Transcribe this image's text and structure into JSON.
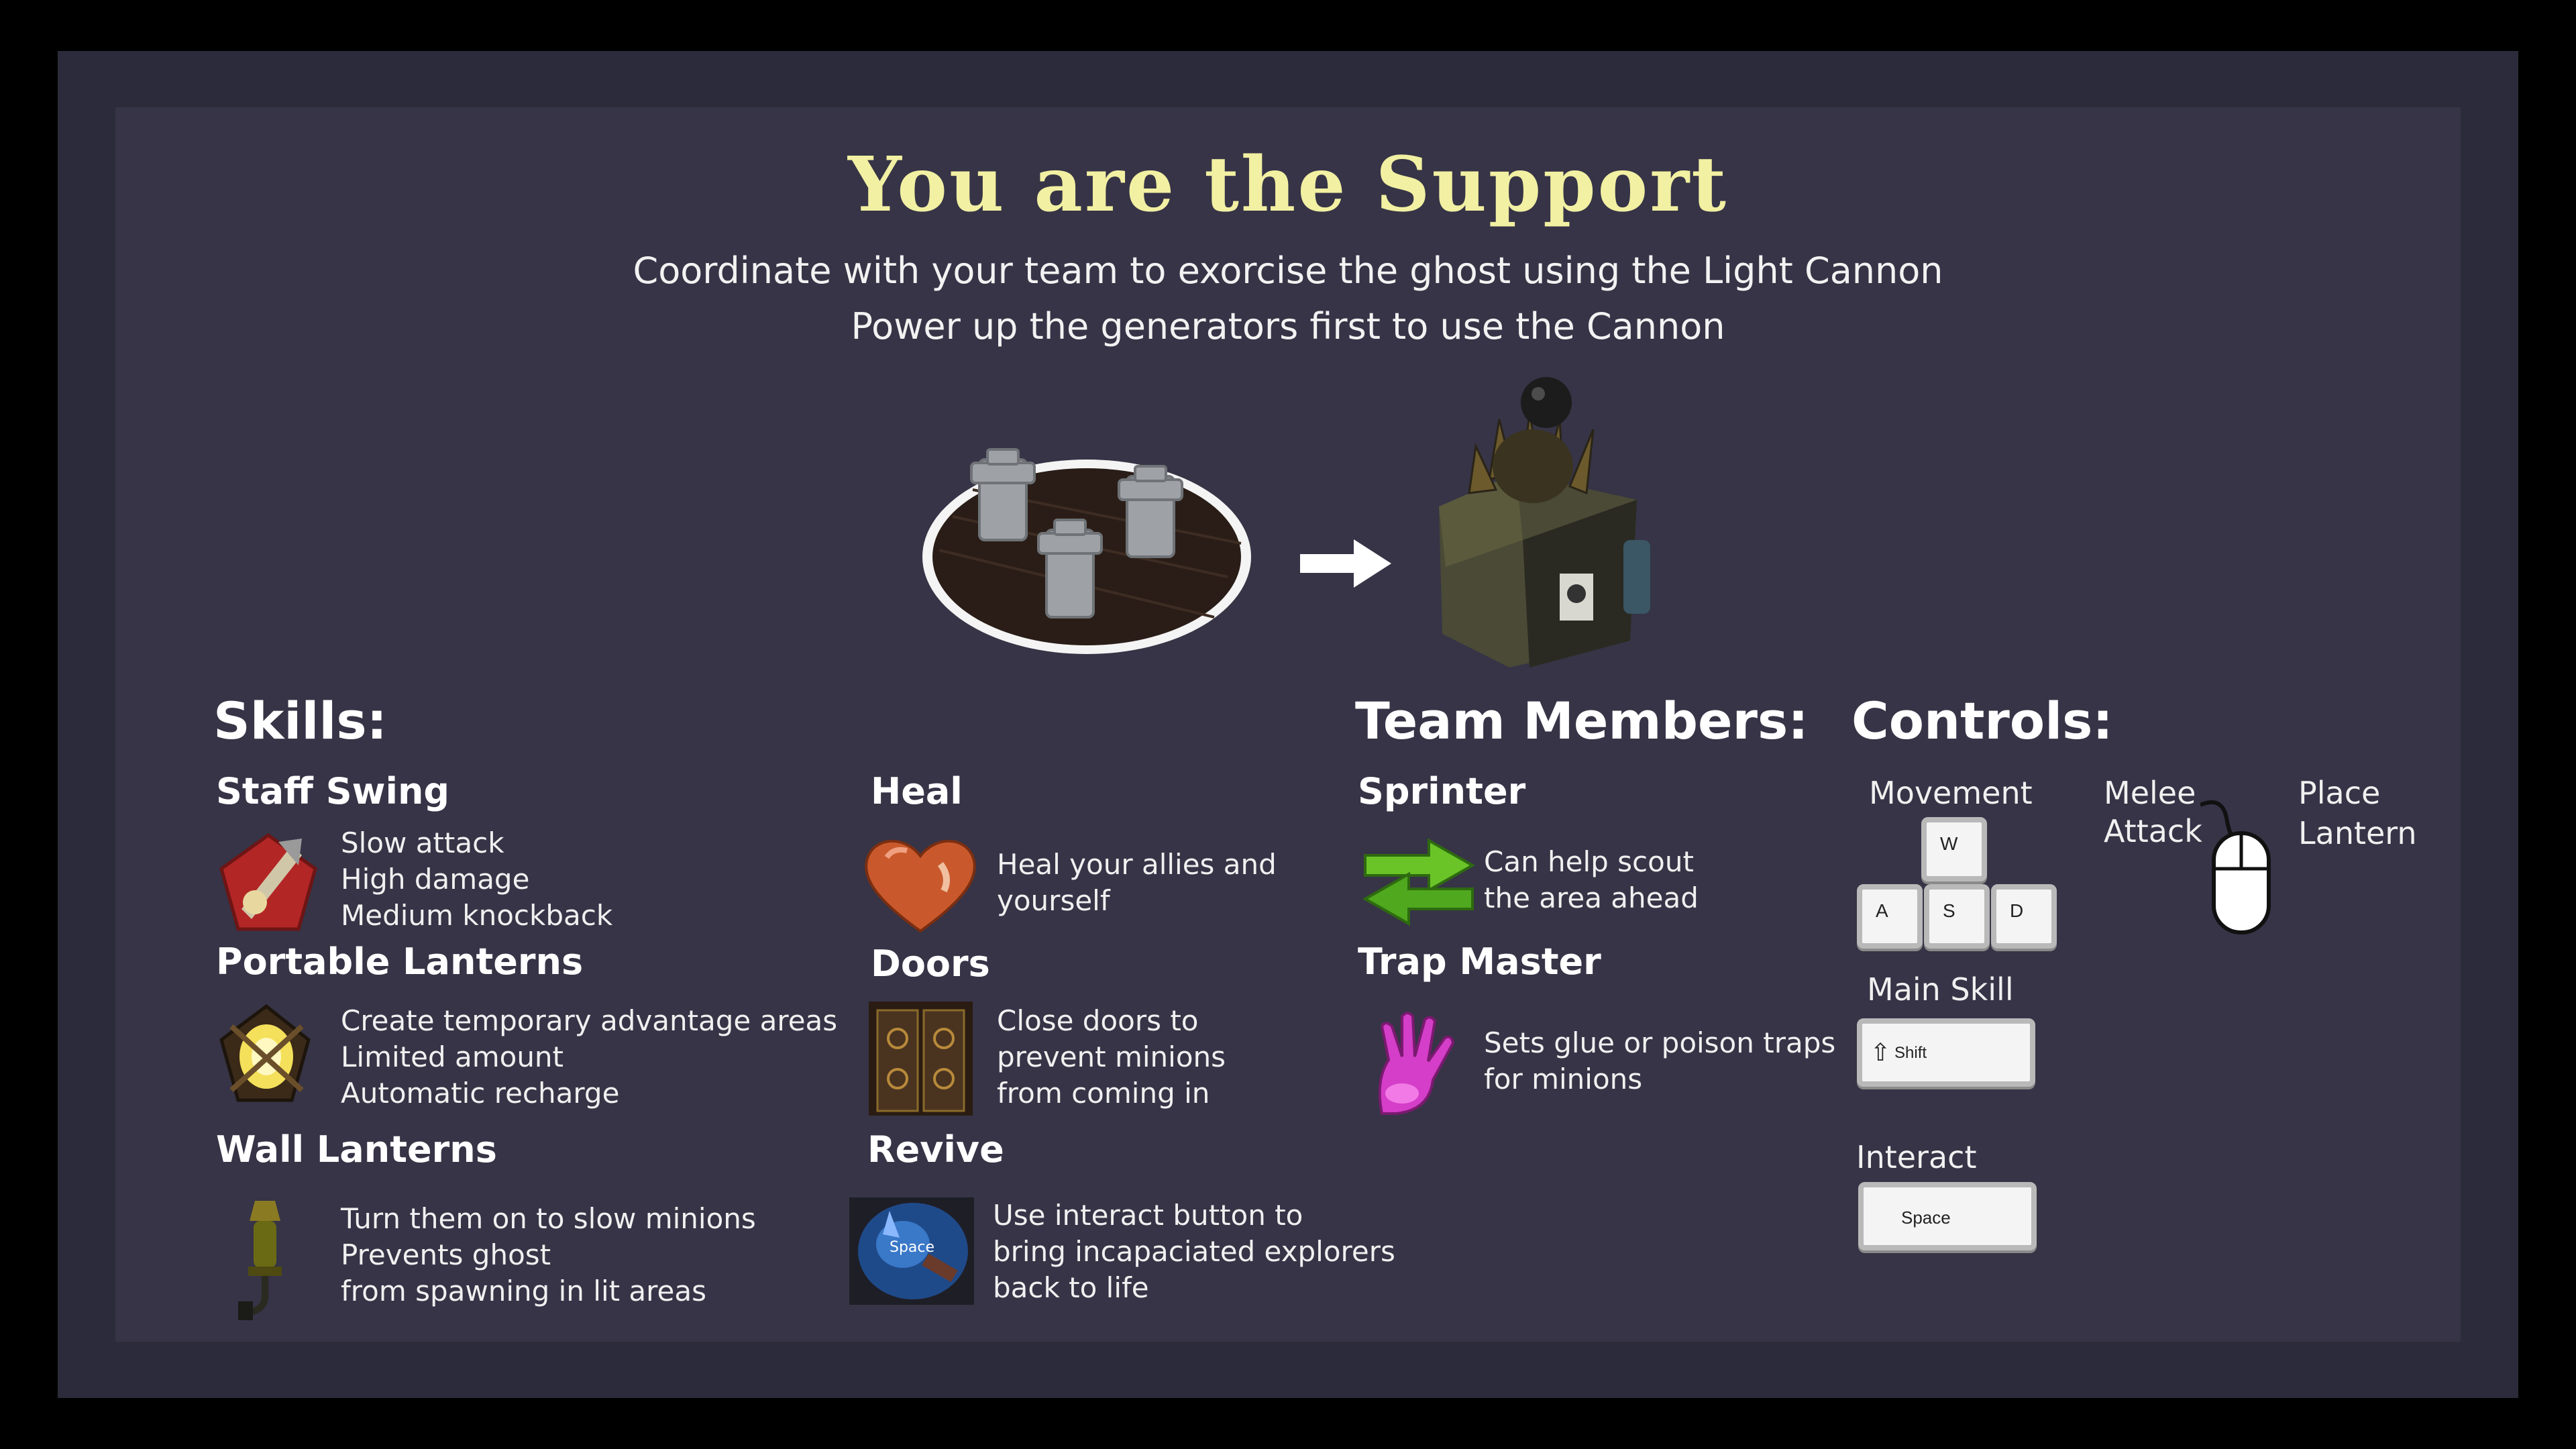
{
  "header": {
    "title": "You are the Support",
    "subtitle_1": "Coordinate with your team to exorcise the ghost using the Light Cannon",
    "subtitle_2": "Power up the generators first to use the Cannon"
  },
  "illustration": {
    "generators_icon": "generators-platform-icon",
    "arrow_icon": "right-arrow-icon",
    "cannon_icon": "light-cannon-icon"
  },
  "skills": {
    "heading": "Skills:",
    "items": [
      {
        "name": "Staff Swing",
        "icon": "staff-swing-icon",
        "lines": [
          "Slow attack",
          "High damage",
          "Medium knockback"
        ]
      },
      {
        "name": "Portable Lanterns",
        "icon": "portable-lantern-icon",
        "lines": [
          "Create temporary advantage areas",
          "Limited amount",
          "Automatic recharge"
        ]
      },
      {
        "name": "Wall Lanterns",
        "icon": "wall-lantern-icon",
        "lines": [
          "Turn them on to slow minions",
          "Prevents ghost",
          "from spawning in lit areas"
        ]
      },
      {
        "name": "Heal",
        "icon": "heart-icon",
        "lines": [
          "Heal your allies and",
          "yourself"
        ]
      },
      {
        "name": "Doors",
        "icon": "door-icon",
        "lines": [
          "Close doors to",
          "prevent minions",
          "from coming in"
        ]
      },
      {
        "name": "Revive",
        "icon": "revive-icon",
        "icon_label": "Space",
        "lines": [
          "Use interact button to",
          "bring incapaciated explorers",
          "back to life"
        ]
      }
    ]
  },
  "team": {
    "heading": "Team Members:",
    "items": [
      {
        "name": "Sprinter",
        "icon": "sprinter-arrows-icon",
        "lines": [
          "Can help scout",
          "the area ahead"
        ]
      },
      {
        "name": "Trap Master",
        "icon": "trap-hand-icon",
        "lines": [
          "Sets glue or poison traps",
          "for minions"
        ]
      }
    ]
  },
  "controls": {
    "heading": "Controls:",
    "movement_label": "Movement",
    "keys": {
      "w": "W",
      "a": "A",
      "s": "S",
      "d": "D",
      "shift": "Shift",
      "space": "Space"
    },
    "main_skill_label": "Main Skill",
    "interact_label": "Interact",
    "melee_label_1": "Melee",
    "melee_label_2": "Attack",
    "place_label_1": "Place",
    "place_label_2": "Lantern",
    "mouse_icon": "mouse-icon"
  },
  "colors": {
    "title": "#f2f0a2",
    "panel": "#363446",
    "frame": "#2c2b3b"
  }
}
